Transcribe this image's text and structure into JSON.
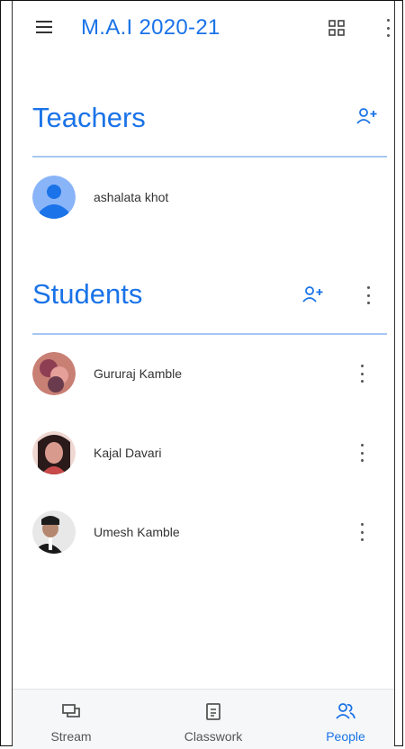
{
  "app_bar": {
    "title": "M.A.I 2020-21",
    "menu_icon": "menu-icon",
    "grid_icon": "qr-grid-icon",
    "more_icon": "more-vertical-icon"
  },
  "teachers": {
    "heading": "Teachers",
    "add_icon": "add-person-icon",
    "items": [
      {
        "name": "ashalata khot",
        "avatar": "default-avatar"
      }
    ]
  },
  "students": {
    "heading": "Students",
    "add_icon": "add-person-icon",
    "more_icon": "more-vertical-icon",
    "items": [
      {
        "name": "Gururaj Kamble",
        "avatar": "photo"
      },
      {
        "name": "Kajal Davari",
        "avatar": "photo"
      },
      {
        "name": "Umesh Kamble",
        "avatar": "photo"
      }
    ]
  },
  "bottom_nav": {
    "items": [
      {
        "label": "Stream",
        "icon": "stream-icon",
        "active": false
      },
      {
        "label": "Classwork",
        "icon": "classwork-icon",
        "active": false
      },
      {
        "label": "People",
        "icon": "people-icon",
        "active": true
      }
    ]
  },
  "colors": {
    "accent": "#1a73e8",
    "divider": "#a7c7f2",
    "nav_bg": "#f6f7f8"
  }
}
